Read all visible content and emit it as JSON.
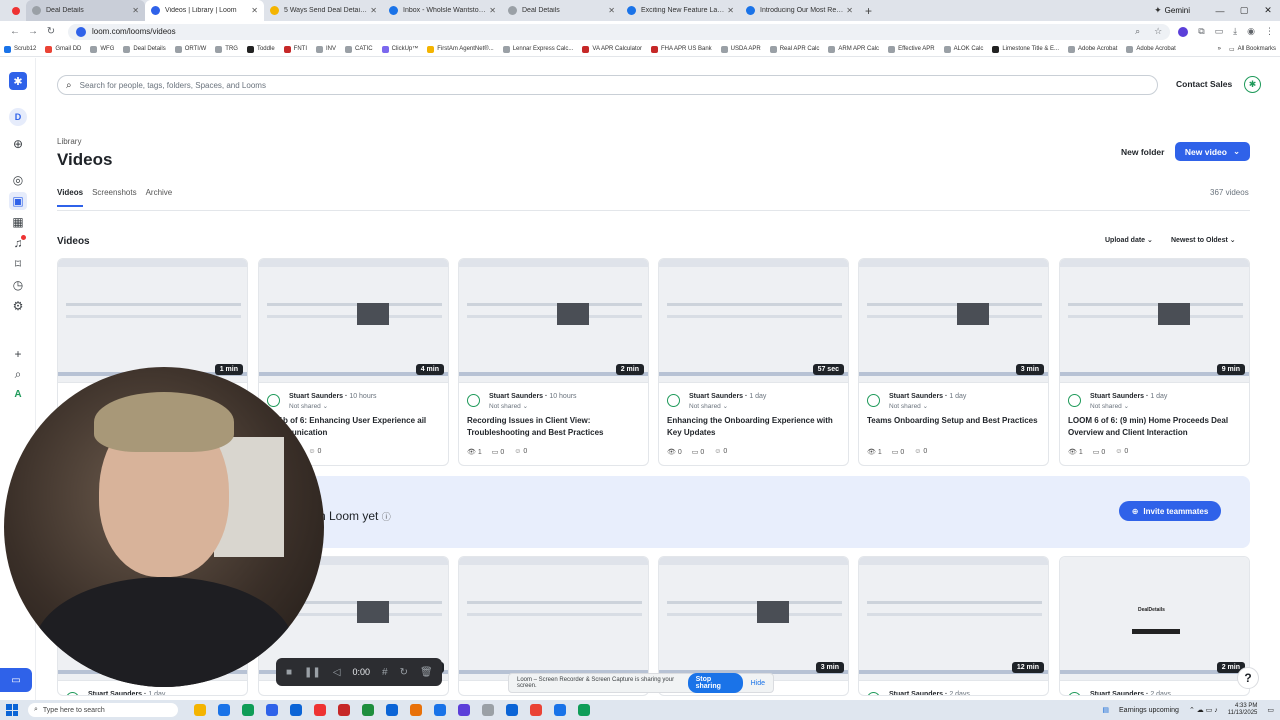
{
  "browser": {
    "tabs": [
      {
        "title": "Deal Details",
        "color": "#9aa0a6",
        "state": "hover"
      },
      {
        "title": "Videos | Library | Loom",
        "color": "#2f62e9",
        "state": "active"
      },
      {
        "title": "5 Ways Send Deal Details - Go...",
        "color": "#f4b400",
        "state": ""
      },
      {
        "title": "Inbox - Wholsle Wantstoee -",
        "color": "#1a73e8",
        "state": ""
      },
      {
        "title": "Deal Details",
        "color": "#9aa0a6",
        "state": ""
      },
      {
        "title": "Exciting New Feature Launch: S...",
        "color": "#1a73e8",
        "state": ""
      },
      {
        "title": "Introducing Our Most Requeste...",
        "color": "#1a73e8",
        "state": ""
      }
    ],
    "new_tab": "+",
    "gemini_label": "Gemini",
    "url": "loom.com/looms/videos",
    "bookmarks": [
      {
        "label": "Scrub12",
        "color": "#1a73e8"
      },
      {
        "label": "Gmail DD",
        "color": "#ea4335"
      },
      {
        "label": "WFG",
        "color": "#9aa0a6"
      },
      {
        "label": "Deal Details",
        "color": "#9aa0a6"
      },
      {
        "label": "ORTI/W",
        "color": "#9aa0a6"
      },
      {
        "label": "TRG",
        "color": "#9aa0a6"
      },
      {
        "label": "Toddle",
        "color": "#222222"
      },
      {
        "label": "FNTI",
        "color": "#c62828"
      },
      {
        "label": "INV",
        "color": "#9aa0a6"
      },
      {
        "label": "CATIC",
        "color": "#9aa0a6"
      },
      {
        "label": "ClickUp™",
        "color": "#7b68ee"
      },
      {
        "label": "FirstAm AgentNet®...",
        "color": "#f4b400"
      },
      {
        "label": "Lennar Express Calc...",
        "color": "#9aa0a6"
      },
      {
        "label": "VA APR Calculator",
        "color": "#c62828"
      },
      {
        "label": "FHA APR US Bank",
        "color": "#c62828"
      },
      {
        "label": "USDA APR",
        "color": "#9aa0a6"
      },
      {
        "label": "Real APR Calc",
        "color": "#9aa0a6"
      },
      {
        "label": "ARM APR Calc",
        "color": "#9aa0a6"
      },
      {
        "label": "Effective APR",
        "color": "#9aa0a6"
      },
      {
        "label": "ALOK Calc",
        "color": "#9aa0a6"
      },
      {
        "label": "Limestone Title & E...",
        "color": "#222222"
      },
      {
        "label": "Adobe Acrobat",
        "color": "#9aa0a6"
      },
      {
        "label": "Adobe Acrobat",
        "color": "#9aa0a6"
      }
    ],
    "all_bookmarks": "All Bookmarks"
  },
  "loom": {
    "sidebar_avatar": "D",
    "sidebar_a": "A",
    "search_placeholder": "Search for people, tags, folders, Spaces, and Looms",
    "contact_sales": "Contact Sales",
    "breadcrumb": "Library",
    "title": "Videos",
    "new_folder": "New folder",
    "new_video": "New video",
    "tabs": [
      "Videos",
      "Screenshots",
      "Archive"
    ],
    "count": "367 videos",
    "section_title": "Videos",
    "sort_field": "Upload date",
    "sort_order": "Newest to Oldest",
    "videos": [
      {
        "duration": "1 min",
        "author": "",
        "ago": "",
        "share": "",
        "title": "",
        "views": "",
        "comments": "",
        "reactions": ""
      },
      {
        "duration": "4 min",
        "author": "Stuart Saunders",
        "ago": "10 hours",
        "share": "Not shared",
        "title": "M: 1b of 6: Enhancing User Experience  ail Communication",
        "views": "",
        "comments": "0",
        "reactions": "0"
      },
      {
        "duration": "2 min",
        "author": "Stuart Saunders",
        "ago": "10 hours",
        "share": "Not shared",
        "title": "Recording Issues in Client View: Troubleshooting and Best Practices",
        "views": "1",
        "comments": "0",
        "reactions": "0"
      },
      {
        "duration": "57 sec",
        "author": "Stuart Saunders",
        "ago": "1 day",
        "share": "Not shared",
        "title": "Enhancing the Onboarding Experience with Key Updates",
        "views": "0",
        "comments": "0",
        "reactions": "0"
      },
      {
        "duration": "3 min",
        "author": "Stuart Saunders",
        "ago": "1 day",
        "share": "Not shared",
        "title": "Teams Onboarding Setup and Best Practices",
        "views": "1",
        "comments": "0",
        "reactions": "0"
      },
      {
        "duration": "9 min",
        "author": "Stuart Saunders",
        "ago": "1 day",
        "share": "Not shared",
        "title": "LOOM 6 of 6: (9 min) Home Proceeds Deal Overview and Client Interaction",
        "views": "1",
        "comments": "0",
        "reactions": "0"
      }
    ],
    "banner_text": "n Loom yet",
    "invite_label": "Invite teammates",
    "videos_row2": [
      {
        "duration": "",
        "author": "Stuart Saunders",
        "ago": "1 day"
      },
      {
        "duration": "8 min",
        "author": "",
        "ago": ""
      },
      {
        "duration": "",
        "author": "",
        "ago": ""
      },
      {
        "duration": "3 min",
        "author": "",
        "ago": ""
      },
      {
        "duration": "12 min",
        "author": "Stuart Saunders",
        "ago": "2 days"
      },
      {
        "duration": "2 min",
        "author": "Stuart Saunders",
        "ago": "2 days"
      }
    ],
    "thumbnail_brand": "DealDetails",
    "recorder_time": "0:00",
    "share_notice": "Loom – Screen Recorder & Screen Capture is sharing your screen.",
    "stop_sharing": "Stop sharing",
    "hide": "Hide",
    "help": "?"
  },
  "taskbar": {
    "search_placeholder": "Type here to search",
    "tray_text": "Earnings upcoming",
    "time": "4:33 PM",
    "date": "11/13/2025",
    "apps": [
      "#f4b400",
      "#1a73e8",
      "#0f9d58",
      "#2f62e9",
      "#0b64d6",
      "#e33",
      "#c62828",
      "#1e8e3e",
      "#0b64d6",
      "#e8710a",
      "#1a73e8",
      "#5b3fd9",
      "#9aa0a6",
      "#0b64d6",
      "#ea4335",
      "#1a73e8",
      "#0f9d58"
    ]
  }
}
